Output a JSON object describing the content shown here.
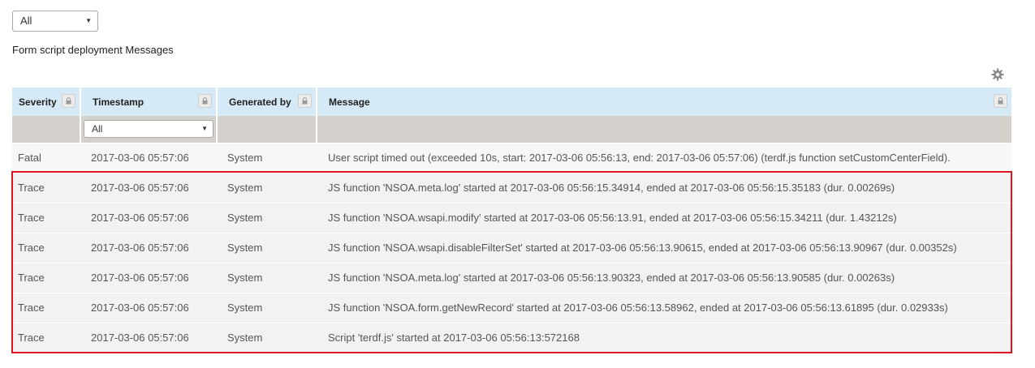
{
  "filters": {
    "severity_filter": {
      "selected": "All"
    },
    "timestamp_filter": {
      "selected": "All"
    }
  },
  "section_title": "Form script deployment Messages",
  "table": {
    "columns": [
      "Severity",
      "Timestamp",
      "Generated by",
      "Message"
    ],
    "rows": [
      [
        "Fatal",
        "2017-03-06 05:57:06",
        "System",
        "User script timed out (exceeded 10s, start: 2017-03-06 05:56:13, end: 2017-03-06 05:57:06) (terdf.js function setCustomCenterField)."
      ],
      [
        "Trace",
        "2017-03-06 05:57:06",
        "System",
        "JS function 'NSOA.meta.log' started at 2017-03-06 05:56:15.34914, ended at 2017-03-06 05:56:15.35183 (dur. 0.00269s)"
      ],
      [
        "Trace",
        "2017-03-06 05:57:06",
        "System",
        "JS function 'NSOA.wsapi.modify' started at 2017-03-06 05:56:13.91, ended at 2017-03-06 05:56:15.34211 (dur. 1.43212s)"
      ],
      [
        "Trace",
        "2017-03-06 05:57:06",
        "System",
        "JS function 'NSOA.wsapi.disableFilterSet' started at 2017-03-06 05:56:13.90615, ended at 2017-03-06 05:56:13.90967 (dur. 0.00352s)"
      ],
      [
        "Trace",
        "2017-03-06 05:57:06",
        "System",
        "JS function 'NSOA.meta.log' started at 2017-03-06 05:56:13.90323, ended at 2017-03-06 05:56:13.90585 (dur. 0.00263s)"
      ],
      [
        "Trace",
        "2017-03-06 05:57:06",
        "System",
        "JS function 'NSOA.form.getNewRecord' started at 2017-03-06 05:56:13.58962, ended at 2017-03-06 05:56:13.61895 (dur. 0.02933s)"
      ],
      [
        "Trace",
        "2017-03-06 05:57:06",
        "System",
        "Script 'terdf.js' started at 2017-03-06 05:56:13:572168"
      ]
    ]
  },
  "colors": {
    "header_bg": "#d6e9f6",
    "filter_bg": "#d4d1cd",
    "row_bg": "#f2f2f2",
    "highlight_border": "#e0141e"
  },
  "icons": {
    "settings": "gear-icon",
    "column_lock": "lock-icon"
  }
}
